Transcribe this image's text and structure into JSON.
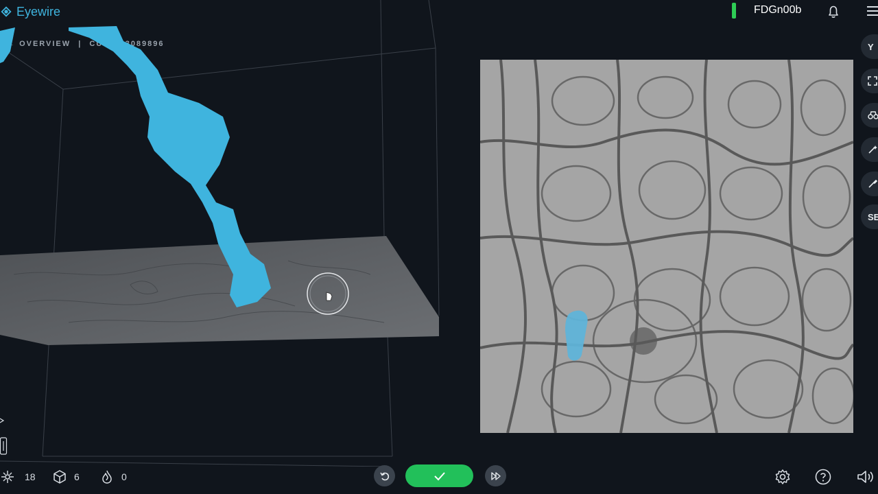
{
  "app": {
    "logo_text": "Eyewire",
    "accent_color": "#3fb4de"
  },
  "breadcrumb": {
    "back_arrow": "←",
    "overview_label": "OVERVIEW",
    "separator": "|",
    "cube_label": "CUBE #3089896"
  },
  "header": {
    "status_color": "#2ecc55",
    "username": "FDGn00b",
    "bell_icon": "bell-icon",
    "menu_icon": "hamburger-icon"
  },
  "rail": {
    "items": [
      {
        "label": "Y",
        "icon": ""
      },
      {
        "label": "",
        "icon": "fullscreen-icon"
      },
      {
        "label": "",
        "icon": "binoculars-icon"
      },
      {
        "label": "",
        "icon": "wand-icon"
      },
      {
        "label": "",
        "icon": "paint-icon"
      },
      {
        "label": "SE",
        "icon": ""
      }
    ]
  },
  "stats": {
    "trailblazer_count": "18",
    "cube_count": "6",
    "flame_count": "0"
  },
  "controls": {
    "undo_icon": "undo-icon",
    "submit_icon": "check-icon",
    "submit_color": "#22c05a",
    "skip_icon": "fast-forward-icon"
  },
  "bottom_right": {
    "icons": [
      "settings-icon",
      "help-icon",
      "audio-icon"
    ]
  },
  "segment_color": "#3fb4de"
}
